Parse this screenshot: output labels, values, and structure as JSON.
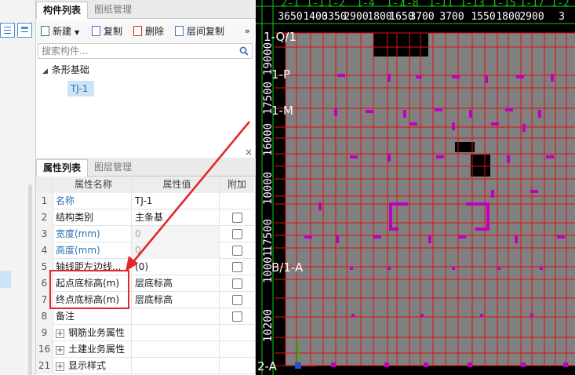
{
  "component_panel": {
    "tabs": [
      {
        "label": "构件列表"
      },
      {
        "label": "图纸管理"
      }
    ],
    "toolbar": {
      "new_label": "新建",
      "copy_label": "复制",
      "delete_label": "删除",
      "floor_copy_label": "层间复制",
      "more_label": "»"
    },
    "search": {
      "placeholder": "搜索构件..."
    },
    "tree": {
      "group_label": "条形基础",
      "child_label": "TJ-1"
    }
  },
  "properties_panel": {
    "close_label": "×",
    "tabs": [
      {
        "label": "属性列表"
      },
      {
        "label": "图层管理"
      }
    ],
    "headers": {
      "name": "属性名称",
      "value": "属性值",
      "add": "附加"
    },
    "rows": [
      {
        "num": "1",
        "name": "名称",
        "value": "TJ-1",
        "checkbox": false,
        "blue": true
      },
      {
        "num": "2",
        "name": "结构类别",
        "value": "主条基",
        "checkbox": true,
        "blue": false
      },
      {
        "num": "3",
        "name": "宽度(mm)",
        "value": "0",
        "checkbox": true,
        "blue": true,
        "value_grey": true
      },
      {
        "num": "4",
        "name": "高度(mm)",
        "value": "0",
        "checkbox": true,
        "blue": true,
        "value_grey": true
      },
      {
        "num": "5",
        "name": "轴线距左边线...",
        "value": "(0)",
        "checkbox": true,
        "blue": false
      },
      {
        "num": "6",
        "name": "起点底标高(m)",
        "value": "层底标高",
        "checkbox": true,
        "blue": false
      },
      {
        "num": "7",
        "name": "终点底标高(m)",
        "value": "层底标高",
        "checkbox": true,
        "blue": false
      },
      {
        "num": "8",
        "name": "备注",
        "value": "",
        "checkbox": true,
        "blue": false
      },
      {
        "num": "9",
        "name": "钢筋业务属性",
        "value": "",
        "checkbox": false,
        "blue": false,
        "expander": "+"
      },
      {
        "num": "16",
        "name": "土建业务属性",
        "value": "",
        "checkbox": false,
        "blue": false,
        "expander": "+"
      },
      {
        "num": "21",
        "name": "显示样式",
        "value": "",
        "checkbox": false,
        "blue": false,
        "expander": "+"
      }
    ]
  },
  "cad": {
    "column_axes": [
      "2-1",
      "1-1",
      "1-2",
      "1-4",
      "1-7",
      "1-8",
      "1-11",
      "1-13",
      "1-15",
      "1-17",
      "1-2"
    ],
    "top_dimensions": [
      "3650",
      "1400",
      "3350",
      "2900",
      "1800",
      "1650",
      "3700",
      "3700",
      "1550",
      "1800",
      "2900",
      "3"
    ],
    "row_axes": [
      "1-Q/1",
      "1-P",
      "1-M",
      "B/1-A",
      "2-A"
    ],
    "left_dimensions": [
      "10200",
      "19000",
      "17500",
      "16000",
      "10000",
      "17500",
      "10001"
    ],
    "colors": {
      "background": "#000000",
      "slab": "#808080",
      "grid": "#e01010",
      "columns": "#c000c0",
      "axis": "#18c418"
    }
  },
  "annotation": {
    "color": "#e3262a"
  }
}
